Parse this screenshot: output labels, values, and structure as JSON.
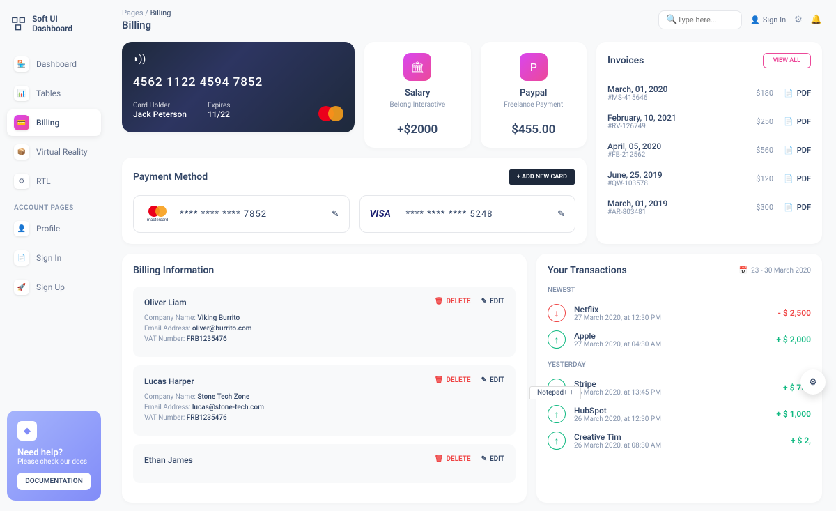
{
  "app": {
    "name": "Soft UI Dashboard"
  },
  "breadcrumb": {
    "root": "Pages",
    "sep": "/",
    "current": "Billing"
  },
  "page_title": "Billing",
  "search": {
    "placeholder": "Type here..."
  },
  "header": {
    "signin": "Sign In"
  },
  "nav": {
    "items": [
      {
        "label": "Dashboard"
      },
      {
        "label": "Tables"
      },
      {
        "label": "Billing"
      },
      {
        "label": "Virtual Reality"
      },
      {
        "label": "RTL"
      }
    ],
    "account_label": "ACCOUNT PAGES",
    "account_items": [
      {
        "label": "Profile"
      },
      {
        "label": "Sign In"
      },
      {
        "label": "Sign Up"
      }
    ]
  },
  "help": {
    "title": "Need help?",
    "sub": "Please check our docs",
    "btn": "DOCUMENTATION"
  },
  "credit_card": {
    "number": "4562   1122   4594   7852",
    "holder_label": "Card Holder",
    "holder": "Jack Peterson",
    "expires_label": "Expires",
    "expires": "11/22"
  },
  "stat1": {
    "title": "Salary",
    "sub": "Belong Interactive",
    "value": "+$2000"
  },
  "stat2": {
    "title": "Paypal",
    "sub": "Freelance Payment",
    "value": "$455.00"
  },
  "invoices": {
    "title": "Invoices",
    "viewall": "VIEW ALL",
    "pdf": "PDF",
    "items": [
      {
        "date": "March, 01, 2020",
        "id": "#MS-415646",
        "amount": "$180"
      },
      {
        "date": "February, 10, 2021",
        "id": "#RV-126749",
        "amount": "$250"
      },
      {
        "date": "April, 05, 2020",
        "id": "#FB-212562",
        "amount": "$560"
      },
      {
        "date": "June, 25, 2019",
        "id": "#QW-103578",
        "amount": "$120"
      },
      {
        "date": "March, 01, 2019",
        "id": "#AR-803481",
        "amount": "$300"
      }
    ]
  },
  "payment": {
    "title": "Payment Method",
    "add_btn": "+  ADD NEW CARD",
    "methods": [
      {
        "brand": "mastercard",
        "number": "****   ****   ****   7852"
      },
      {
        "brand": "visa",
        "number": "****   ****   ****   5248"
      }
    ]
  },
  "billing": {
    "title": "Billing Information",
    "delete": "DELETE",
    "edit": "EDIT",
    "company_label": "Company Name:",
    "email_label": "Email Address:",
    "vat_label": "VAT Number:",
    "items": [
      {
        "name": "Oliver Liam",
        "company": "Viking Burrito",
        "email": "oliver@burrito.com",
        "vat": "FRB1235476"
      },
      {
        "name": "Lucas Harper",
        "company": "Stone Tech Zone",
        "email": "lucas@stone-tech.com",
        "vat": "FRB1235476"
      },
      {
        "name": "Ethan James",
        "company": "",
        "email": "",
        "vat": ""
      }
    ]
  },
  "transactions": {
    "title": "Your Transactions",
    "range": "23 - 30 March 2020",
    "newest": "NEWEST",
    "yesterday": "YESTERDAY",
    "newest_items": [
      {
        "name": "Netflix",
        "time": "27 March 2020, at 12:30 PM",
        "amount": "- $ 2,500",
        "dir": "down"
      },
      {
        "name": "Apple",
        "time": "27 March 2020, at 04:30 AM",
        "amount": "+ $ 2,000",
        "dir": "up"
      }
    ],
    "yesterday_items": [
      {
        "name": "Stripe",
        "time": "26 March 2020, at 13:45 PM",
        "amount": "+ $ 750",
        "dir": "up"
      },
      {
        "name": "HubSpot",
        "time": "26 March 2020, at 12:30 PM",
        "amount": "+ $ 1,000",
        "dir": "up"
      },
      {
        "name": "Creative Tim",
        "time": "26 March 2020, at 08:30 AM",
        "amount": "+ $ 2,",
        "dir": "up"
      }
    ]
  },
  "notepad": "Notepad+ +"
}
